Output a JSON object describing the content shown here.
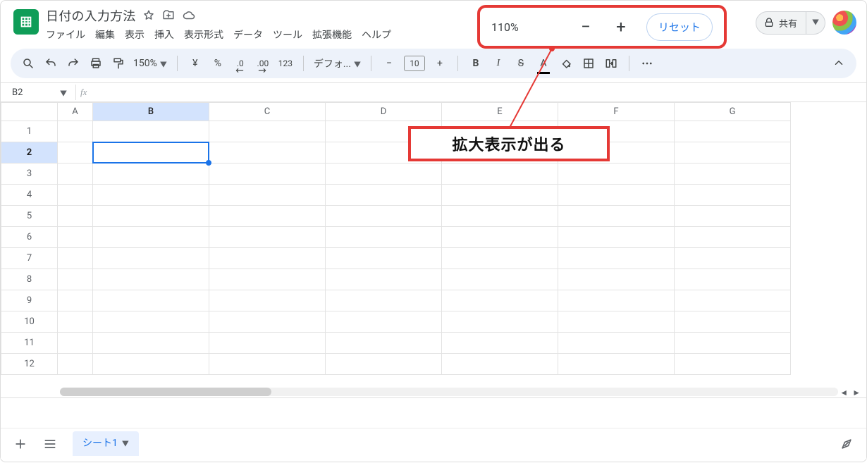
{
  "doc": {
    "title": "日付の入力方法"
  },
  "menu": {
    "file": "ファイル",
    "edit": "編集",
    "view": "表示",
    "insert": "挿入",
    "format": "表示形式",
    "data": "データ",
    "tools": "ツール",
    "extensions": "拡張機能",
    "help": "ヘルプ"
  },
  "zoom_overlay": {
    "percent": "110%",
    "reset": "リセット"
  },
  "share": {
    "label": "共有"
  },
  "toolbar": {
    "zoom": "150%",
    "currency": "¥",
    "percent": "%",
    "dec_dec": ".0",
    "dec_inc": ".00",
    "numfmt": "123",
    "font": "デフォ...",
    "font_size": "10"
  },
  "namebox": {
    "value": "B2"
  },
  "fx": {
    "label": "fx"
  },
  "callout": {
    "text": "拡大表示が出る"
  },
  "columns": [
    "A",
    "B",
    "C",
    "D",
    "E",
    "F",
    "G"
  ],
  "rows": [
    "1",
    "2",
    "3",
    "4",
    "5",
    "6",
    "7",
    "8",
    "9",
    "10",
    "11",
    "12"
  ],
  "active": {
    "cell": "B2",
    "colIndex": 1,
    "rowIndex": 1
  },
  "sheet": {
    "tab": "シート1"
  }
}
